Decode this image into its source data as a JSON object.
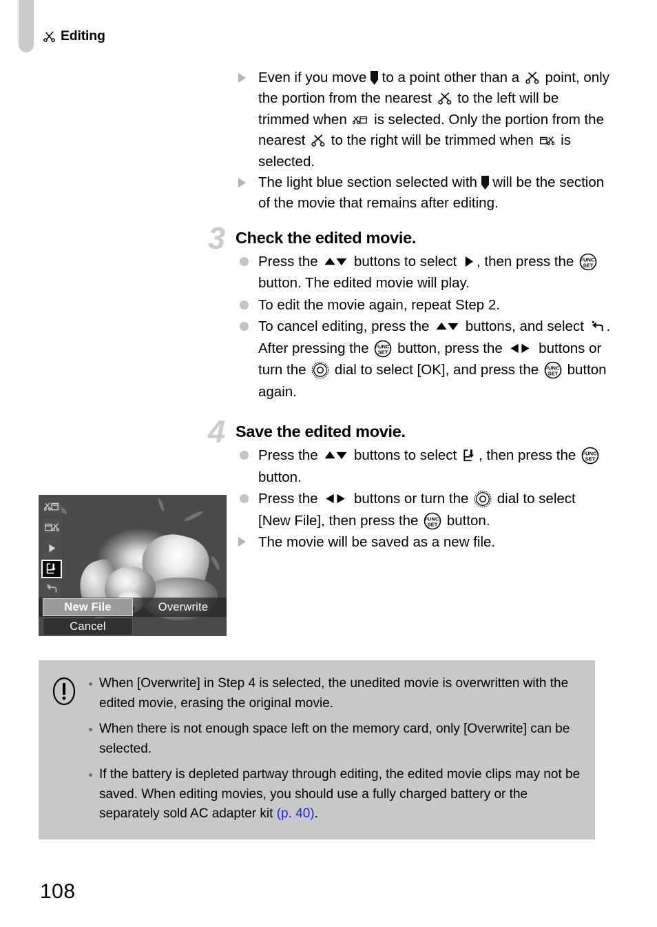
{
  "header": {
    "chapter_icon": "scissors-icon",
    "chapter_title": "Editing"
  },
  "intro_notes": [
    {
      "marker": "arrow",
      "segments": [
        {
          "t": "text",
          "v": "Even if you move "
        },
        {
          "t": "icon",
          "v": "marker-icon"
        },
        {
          "t": "text",
          "v": " to a point other than a "
        },
        {
          "t": "icon",
          "v": "scissors-icon"
        },
        {
          "t": "text",
          "v": " point, only the portion from the nearest "
        },
        {
          "t": "icon",
          "v": "scissors-icon"
        },
        {
          "t": "text",
          "v": " to the left will be trimmed when "
        },
        {
          "t": "icon",
          "v": "trim-left-icon"
        },
        {
          "t": "text",
          "v": " is selected. Only the portion from the nearest "
        },
        {
          "t": "icon",
          "v": "scissors-icon"
        },
        {
          "t": "text",
          "v": " to the right will be trimmed when "
        },
        {
          "t": "icon",
          "v": "trim-right-icon"
        },
        {
          "t": "text",
          "v": " is selected."
        }
      ]
    },
    {
      "marker": "arrow",
      "segments": [
        {
          "t": "text",
          "v": "The light blue section selected with "
        },
        {
          "t": "icon",
          "v": "marker-icon"
        },
        {
          "t": "text",
          "v": " will be the section of the movie that remains after editing."
        }
      ]
    }
  ],
  "steps": [
    {
      "number": "3",
      "title": "Check the edited movie.",
      "items": [
        {
          "marker": "bullet",
          "segments": [
            {
              "t": "text",
              "v": "Press the "
            },
            {
              "t": "icon",
              "v": "up-down-buttons-icon"
            },
            {
              "t": "text",
              "v": " buttons to select "
            },
            {
              "t": "icon",
              "v": "play-icon"
            },
            {
              "t": "text",
              "v": ", then press the "
            },
            {
              "t": "icon",
              "v": "func-set-button-icon"
            },
            {
              "t": "text",
              "v": " button. The edited movie will play."
            }
          ]
        },
        {
          "marker": "bullet",
          "segments": [
            {
              "t": "text",
              "v": "To edit the movie again, repeat Step 2."
            }
          ]
        },
        {
          "marker": "bullet",
          "segments": [
            {
              "t": "text",
              "v": "To cancel editing, press the "
            },
            {
              "t": "icon",
              "v": "up-down-buttons-icon"
            },
            {
              "t": "text",
              "v": " buttons, and select "
            },
            {
              "t": "icon",
              "v": "undo-icon"
            },
            {
              "t": "text",
              "v": ". After pressing the "
            },
            {
              "t": "icon",
              "v": "func-set-button-icon"
            },
            {
              "t": "text",
              "v": " button, press the "
            },
            {
              "t": "icon",
              "v": "left-right-buttons-icon"
            },
            {
              "t": "text",
              "v": " buttons or turn the "
            },
            {
              "t": "icon",
              "v": "control-dial-icon"
            },
            {
              "t": "text",
              "v": " dial to select [OK], and press the "
            },
            {
              "t": "icon",
              "v": "func-set-button-icon"
            },
            {
              "t": "text",
              "v": " button again."
            }
          ]
        }
      ]
    },
    {
      "number": "4",
      "title": "Save the edited movie.",
      "items": [
        {
          "marker": "bullet",
          "segments": [
            {
              "t": "text",
              "v": "Press the "
            },
            {
              "t": "icon",
              "v": "up-down-buttons-icon"
            },
            {
              "t": "text",
              "v": " buttons to select "
            },
            {
              "t": "icon",
              "v": "save-new-file-icon"
            },
            {
              "t": "text",
              "v": ", then press the "
            },
            {
              "t": "icon",
              "v": "func-set-button-icon"
            },
            {
              "t": "text",
              "v": " button."
            }
          ]
        },
        {
          "marker": "bullet",
          "segments": [
            {
              "t": "text",
              "v": "Press the "
            },
            {
              "t": "icon",
              "v": "left-right-buttons-icon"
            },
            {
              "t": "text",
              "v": " buttons or turn the "
            },
            {
              "t": "icon",
              "v": "control-dial-icon"
            },
            {
              "t": "text",
              "v": " dial to select [New File], then press the "
            },
            {
              "t": "icon",
              "v": "func-set-button-icon"
            },
            {
              "t": "text",
              "v": " button."
            }
          ]
        },
        {
          "marker": "arrow",
          "segments": [
            {
              "t": "text",
              "v": "The movie will be saved as a new file."
            }
          ]
        }
      ]
    }
  ],
  "camera_screen": {
    "icon_column": [
      {
        "name": "trim-left-icon",
        "selected": false
      },
      {
        "name": "trim-right-icon",
        "selected": false
      },
      {
        "name": "play-icon",
        "selected": false
      },
      {
        "name": "save-new-file-icon",
        "selected": true
      },
      {
        "name": "undo-icon",
        "selected": false
      }
    ],
    "menu": {
      "new_file": "New File",
      "overwrite": "Overwrite",
      "cancel": "Cancel",
      "selected": "New File"
    }
  },
  "caution": {
    "icon": "exclamation-circle-icon",
    "items": [
      {
        "segments": [
          {
            "t": "text",
            "v": "When [Overwrite] in Step 4 is selected, the unedited movie is overwritten with the edited movie, erasing the original movie."
          }
        ]
      },
      {
        "segments": [
          {
            "t": "text",
            "v": "When there is not enough space left on the memory card, only [Overwrite] can be selected."
          }
        ]
      },
      {
        "segments": [
          {
            "t": "text",
            "v": "If the battery is depleted partway through editing, the edited movie clips may not be saved. When editing movies, you should use a fully charged battery or the separately sold AC adapter kit "
          },
          {
            "t": "xref",
            "v": "(p. 40)"
          },
          {
            "t": "text",
            "v": "."
          }
        ]
      }
    ]
  },
  "footer": {
    "page_number": "108"
  },
  "colors": {
    "tab_gray": "#c9c9c9",
    "step_number_gray": "#cccccc",
    "bullet_gray": "#c4c4c4",
    "arrow_gray": "#b4b4b4",
    "caution_bg": "#c8c8c8",
    "xref_blue": "#2222dd"
  }
}
